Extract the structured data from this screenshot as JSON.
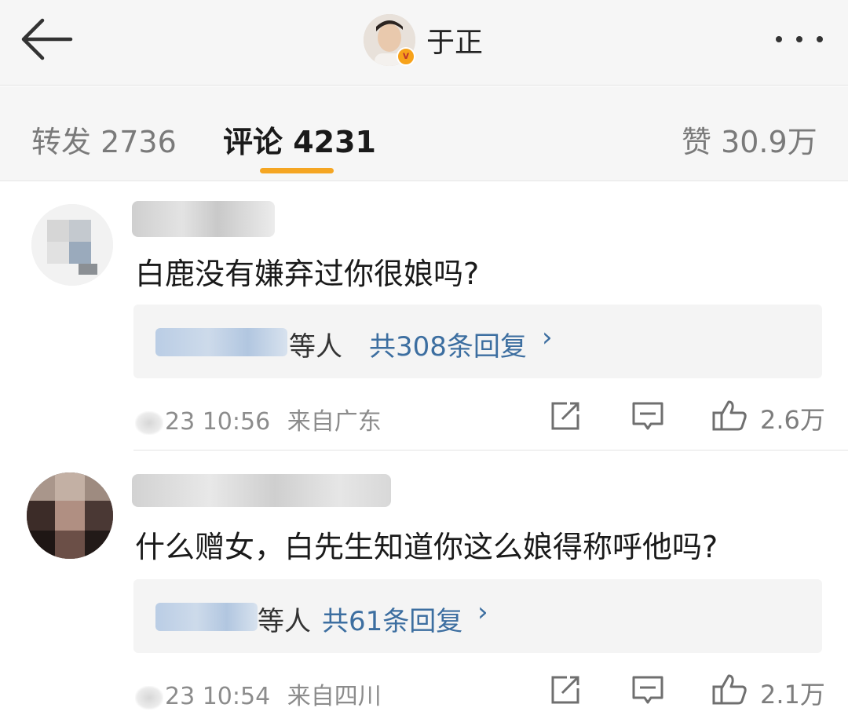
{
  "header": {
    "title": "于正",
    "verified_badge": "v",
    "back_icon": "arrow-left-icon",
    "more_icon": "more-dots-icon"
  },
  "tabs": [
    {
      "label": "转发 2736",
      "active": false
    },
    {
      "label": "评论 4231",
      "active": true
    },
    {
      "label": "赞 30.9万",
      "active": false
    }
  ],
  "accent_color": "#f5a623",
  "link_color": "#3c6ea0",
  "comments": [
    {
      "text": "白鹿没有嫌弃过你很娘吗?",
      "replies_by": "等人",
      "replies_count": "共308条回复",
      "chevron": "›",
      "time": "23 10:56",
      "location": "来自广东",
      "likes": "2.6万"
    },
    {
      "text": "什么赠女，白先生知道你这么娘得称呼他吗?",
      "replies_by": "等人",
      "replies_count": "共61条回复",
      "chevron": "›",
      "time": "23 10:54",
      "location": "来自四川",
      "likes": "2.1万"
    }
  ]
}
